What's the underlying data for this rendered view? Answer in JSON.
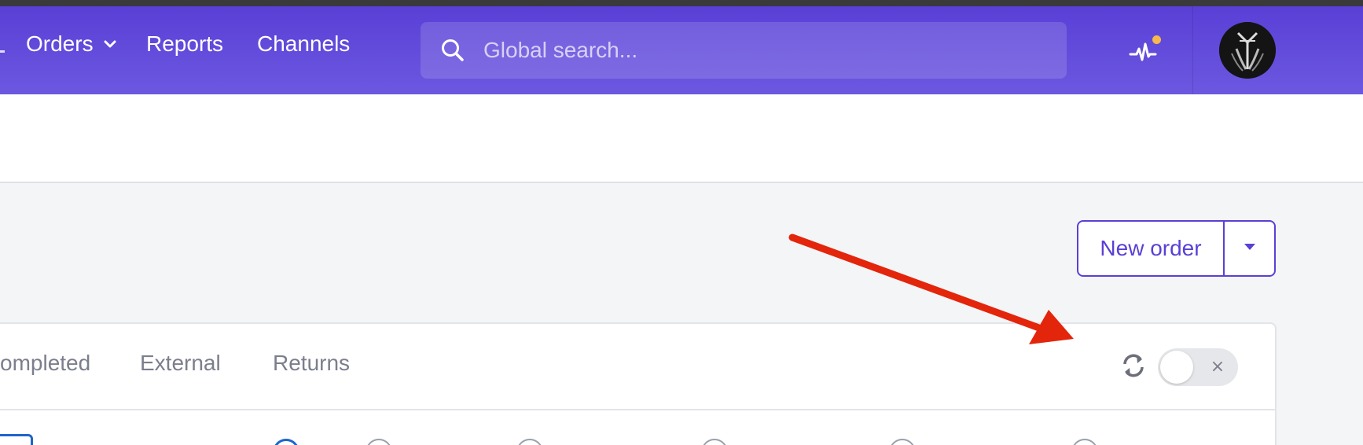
{
  "nav": {
    "items": [
      {
        "label": "Orders",
        "has_dropdown": true
      },
      {
        "label": "Reports"
      },
      {
        "label": "Channels"
      }
    ],
    "search_placeholder": "Global search...",
    "activity_icon": "activity-pulse-icon",
    "avatar": "user-avatar"
  },
  "actions": {
    "new_order_label": "New order"
  },
  "tabs": [
    {
      "label": "ompleted"
    },
    {
      "label": "External"
    },
    {
      "label": "Returns"
    }
  ],
  "auto_refresh": {
    "enabled": false,
    "off_symbol": "×"
  },
  "colors": {
    "brand": "#5b3fd6",
    "annotation_arrow": "#e3250c",
    "activity_dot": "#f7b84b",
    "selected_radio": "#1e66c9"
  }
}
